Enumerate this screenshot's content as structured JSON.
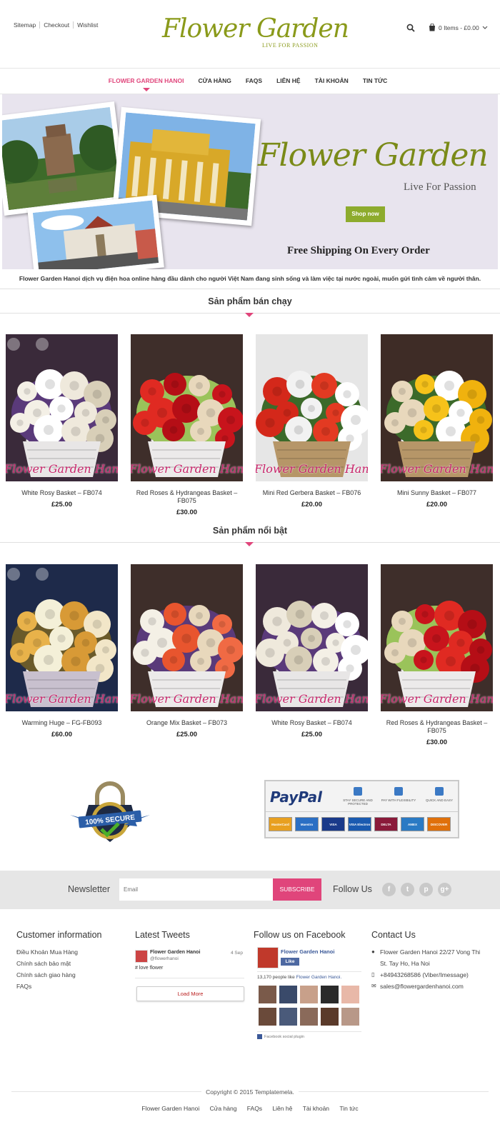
{
  "header": {
    "top_links": [
      "Sitemap",
      "Checkout",
      "Wishlist"
    ],
    "logo_title": "Flower Garden",
    "logo_tagline": "LIVE FOR PASSION",
    "cart_label": "0 Items - £0.00"
  },
  "nav": {
    "items": [
      "FLOWER GARDEN HANOI",
      "CỬA HÀNG",
      "FAQS",
      "LIÊN HỆ",
      "TÀI KHOẢN",
      "TIN TỨC"
    ],
    "active": "FLOWER GARDEN HANOI"
  },
  "banner": {
    "title": "Flower Garden",
    "subtitle": "Live For Passion",
    "button": "Shop now",
    "shipping": "Free Shipping On Every Order"
  },
  "tagline": "Flower Garden Hanoi dịch vụ điện hoa online hàng đầu dành cho người Việt Nam đang sinh sống và làm việc tại nước ngoài, muốn gửi tình cảm về người thân.",
  "bestsellers": {
    "title": "Sản phẩm bán chạy",
    "products": [
      {
        "name": "White Rosy Basket – FB074",
        "price": "£25.00",
        "watermark": "Flower Garden Hanoi"
      },
      {
        "name": "Red Roses & Hydrangeas Basket – FB075",
        "price": "£30.00",
        "watermark": "Flower Garden Hanoi"
      },
      {
        "name": "Mini Red Gerbera Basket – FB076",
        "price": "£20.00",
        "watermark": "Flower Garden Hanoi"
      },
      {
        "name": "Mini Sunny Basket – FB077",
        "price": "£20.00",
        "watermark": "Flower Garden Hanoi"
      }
    ]
  },
  "featured": {
    "title": "Sản phẩm nổi bật",
    "products": [
      {
        "name": "Warming Huge – FG-FB093",
        "price": "£60.00",
        "watermark": "Flower Garden Hanoi"
      },
      {
        "name": "Orange Mix Basket – FB073",
        "price": "£25.00",
        "watermark": "Flower Garden Hanoi"
      },
      {
        "name": "White Rosy Basket – FB074",
        "price": "£25.00",
        "watermark": "Flower Garden Hanoi"
      },
      {
        "name": "Red Roses & Hydrangeas Basket – FB075",
        "price": "£30.00",
        "watermark": "Flower Garden Hanoi"
      }
    ]
  },
  "badges": {
    "secure_text": "100% SECURE",
    "paypal_logo": "PayPal",
    "paypal_features": [
      "STAY SECURE AND PROTECTED",
      "PAY WITH FLEXIBILITY",
      "QUICK AND EASY"
    ],
    "cards": [
      "MasterCard",
      "Maestro",
      "VISA",
      "VISA Electron",
      "DELTA",
      "AMEX",
      "DISCOVER"
    ]
  },
  "newsletter": {
    "label": "Newsletter",
    "placeholder": "Email",
    "button": "SUBSCRIBE",
    "follow_label": "Follow Us",
    "social_icons": [
      "facebook-icon",
      "twitter-icon",
      "pinterest-icon",
      "google-plus-icon"
    ]
  },
  "footer": {
    "customer": {
      "title": "Customer information",
      "links": [
        "Điều Khoản Mua Hàng",
        "Chính sách bảo mật",
        "Chính sách giao hàng",
        "FAQs"
      ]
    },
    "tweets": {
      "title": "Latest Tweets",
      "author": "Flower Garden Hanoi",
      "handle": "@flowerhanoi",
      "date": "4 Sep",
      "text": "# love flower",
      "load_more": "Load More"
    },
    "facebook": {
      "title": "Follow us on Facebook",
      "page_name": "Flower Garden Hanoi",
      "like_button": "Like",
      "likes_prefix": "13,170 people like",
      "likes_page": "Flower Garden Hanoi.",
      "plugin_label": "Facebook social plugin"
    },
    "contact": {
      "title": "Contact Us",
      "address": "Flower Garden Hanoi 22/27 Vong Thi St. Tay Ho, Ha Noi",
      "phone": "+84943268586 (Viber/Imessage)",
      "email": "sales@flowergardenhanoi.com"
    },
    "copyright": "Copyright © 2015 Templatemela.",
    "bottom_links": [
      "Flower Garden Hanoi",
      "Cửa hàng",
      "FAQs",
      "Liên hệ",
      "Tài khoản",
      "Tin tức"
    ]
  },
  "colors": {
    "accent_pink": "#e0457b",
    "logo_green": "#8a9a1a",
    "shop_button": "#8dab2d"
  }
}
